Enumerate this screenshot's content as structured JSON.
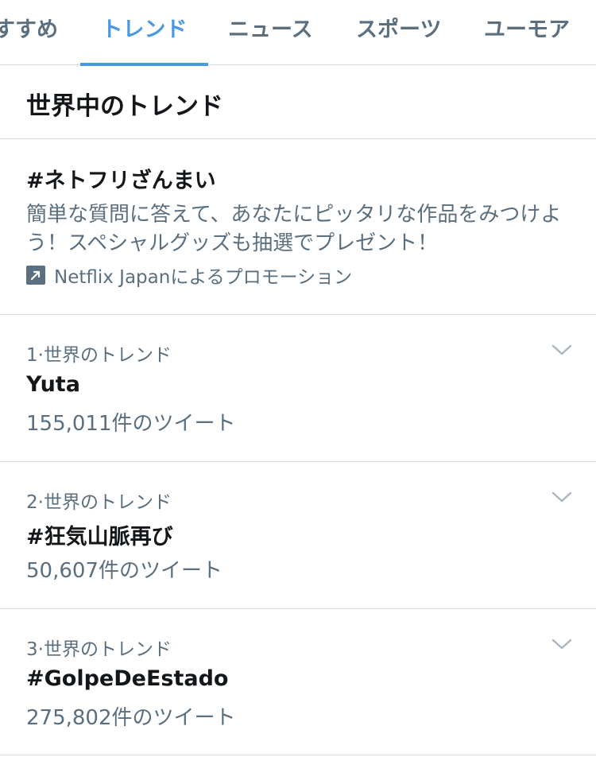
{
  "tabs": [
    {
      "label": "すすめ",
      "active": false
    },
    {
      "label": "トレンド",
      "active": true
    },
    {
      "label": "ニュース",
      "active": false
    },
    {
      "label": "スポーツ",
      "active": false
    },
    {
      "label": "ユーモア",
      "active": false
    }
  ],
  "section_title": "世界中のトレンド",
  "promoted": {
    "hashtag": "#ネトフリざんまい",
    "description": "簡単な質問に答えて、あなたにピッタリな作品をみつけよう！スペシャルグッズも抽選でプレゼント！",
    "promoted_by": "Netflix Japanによるプロモーション",
    "icon": "promoted-arrow-icon"
  },
  "trends": [
    {
      "meta": "1·世界のトレンド",
      "name": "Yuta",
      "count": "155,011件のツイート"
    },
    {
      "meta": "2·世界のトレンド",
      "name": "#狂気山脈再び",
      "count": "50,607件のツイート"
    },
    {
      "meta": "3·世界のトレンド",
      "name": "#GolpeDeEstado",
      "count": "275,802件のツイート"
    }
  ],
  "colors": {
    "accent": "#4a99e3",
    "secondary_text": "#5b6f7f",
    "primary_text": "#14171a",
    "divider": "#d5dce1"
  }
}
